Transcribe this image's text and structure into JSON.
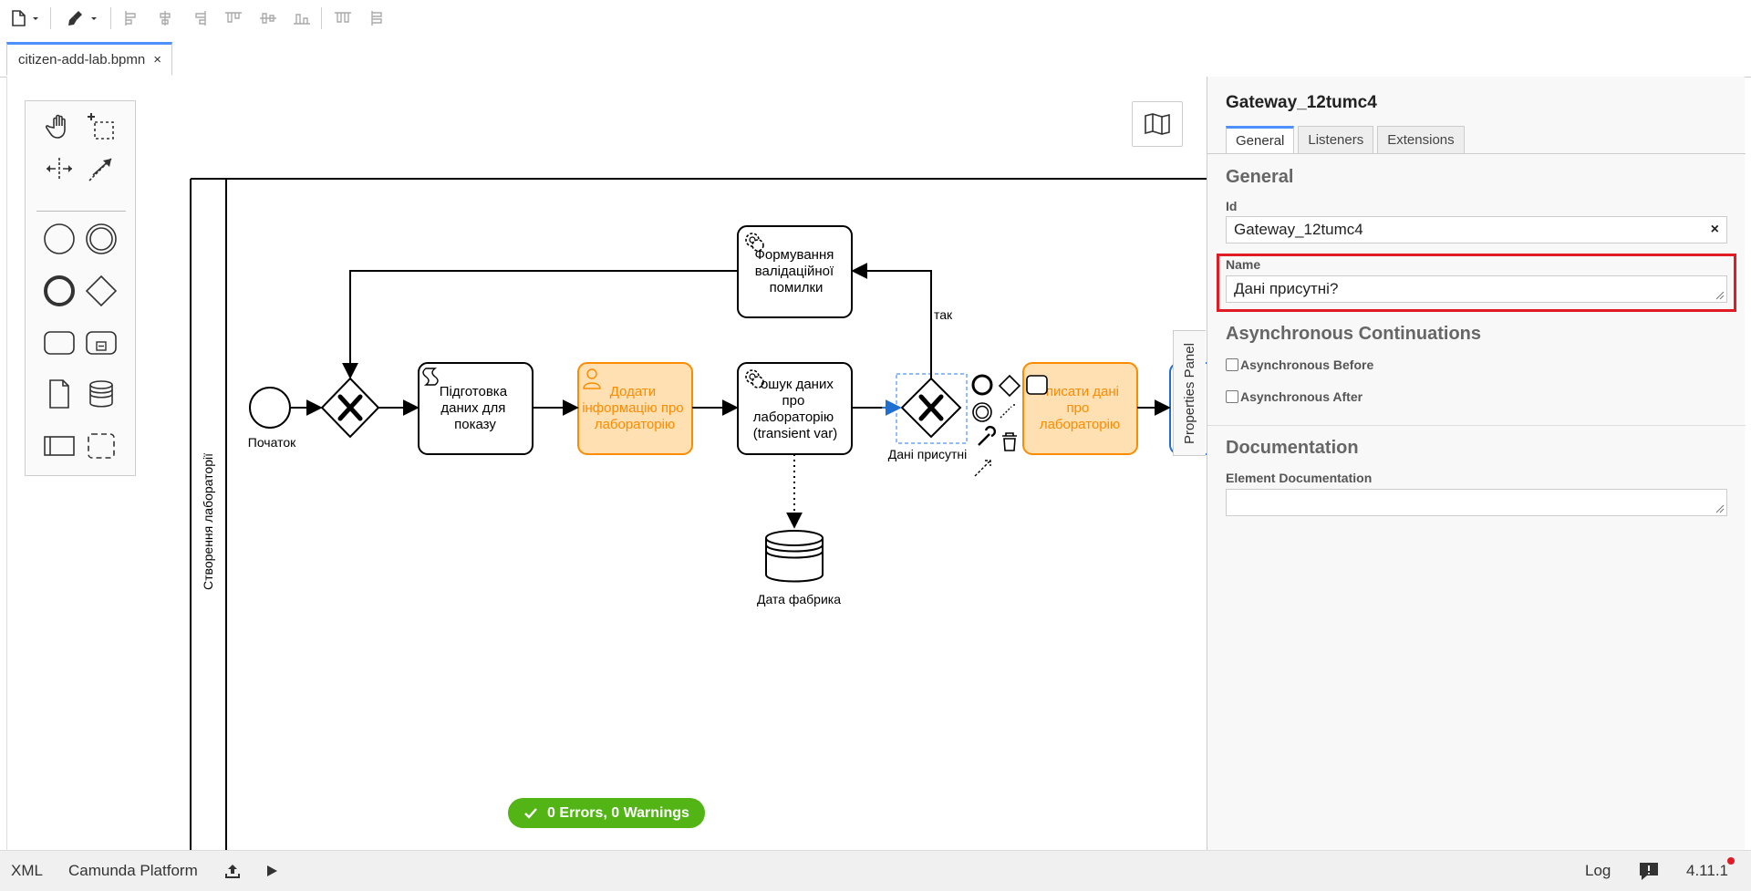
{
  "toolbar": {
    "items": [
      "file-icon",
      "paint-icon",
      "align-left-icon",
      "align-center-icon",
      "align-right-icon",
      "align-top-icon",
      "align-middle-icon",
      "align-bottom-icon",
      "distribute-horizontal-icon",
      "distribute-vertical-icon"
    ]
  },
  "tab": {
    "label": "citizen-add-lab.bpmn",
    "close": "×"
  },
  "diagram": {
    "pool_label": "Створення лабораторії",
    "start_event": "Початок",
    "task_prepare": [
      "Підготовка",
      "даних для",
      "показу"
    ],
    "task_add_info": [
      "Додати",
      "інформацію про",
      "лабораторію"
    ],
    "task_search": [
      "ошук даних",
      "про",
      "лабораторію",
      "(transient var)"
    ],
    "task_validation": [
      "Формування",
      "валідаційної",
      "помилки"
    ],
    "task_write": [
      "писати дані",
      "про",
      "лабораторію"
    ],
    "gateway_label": "Дані присутні",
    "flow_yes": "так",
    "datastore_label": "Дата фабрика"
  },
  "status": {
    "text": "0 Errors, 0 Warnings"
  },
  "properties_toggle": "Properties Panel",
  "panel": {
    "title": "Gateway_12tumc4",
    "tabs": [
      "General",
      "Listeners",
      "Extensions"
    ],
    "general_title": "General",
    "id_label": "Id",
    "id_value": "Gateway_12tumc4",
    "name_label": "Name",
    "name_value": "Дані присутні?",
    "async_title": "Asynchronous Continuations",
    "async_before": "Asynchronous Before",
    "async_after": "Asynchronous After",
    "doc_title": "Documentation",
    "doc_label": "Element Documentation",
    "clear": "×"
  },
  "bottom": {
    "xml": "XML",
    "platform": "Camunda Platform",
    "log": "Log",
    "version": "4.11.1"
  },
  "colors": {
    "accent": "#4d90fe",
    "user_task_fill": "#ffe0b2",
    "user_task_stroke": "#fb8c00",
    "status_green": "#52b415",
    "highlight_red": "#e01b24"
  }
}
